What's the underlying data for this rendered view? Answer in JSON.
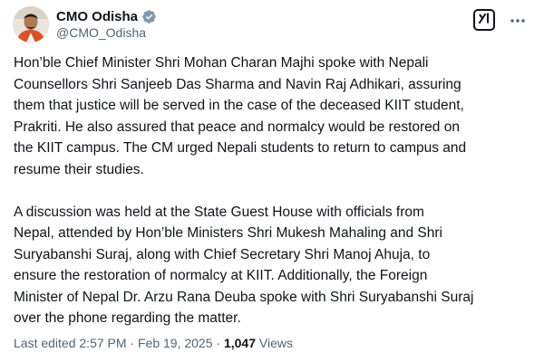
{
  "author": {
    "display_name": "CMO Odisha",
    "handle": "@CMO_Odisha",
    "verified": true,
    "verified_badge": "verified-gray-icon",
    "badge_color": "#829aab"
  },
  "actions": {
    "grok_icon": "grok-icon",
    "more_icon": "more-icon"
  },
  "tweet": {
    "paragraphs": [
      {
        "lines": [
          "Hon’ble Chief Minister Shri Mohan Charan Majhi spoke with Nepali",
          "Counsellors Shri Sanjeeb Das Sharma and Navin Raj Adhikari, assuring",
          "them that justice will be served in the case of the deceased KIIT student,",
          "Prakriti. He also assured that peace and normalcy would be restored on",
          "the KIIT campus. The CM urged Nepali students to return to campus and",
          "resume their studies."
        ]
      },
      {
        "lines": [
          "A discussion was held at the State Guest House with officials from",
          "Nepal, attended by Hon’ble Ministers Shri Mukesh Mahaling and Shri",
          "Suryabanshi Suraj, along with Chief Secretary Shri Manoj Ahuja, to",
          "ensure the restoration of normalcy at KIIT. Additionally, the Foreign",
          "Minister of Nepal Dr. Arzu Rana Deuba spoke with Shri Suryabanshi Suraj",
          "over the phone regarding the matter."
        ]
      }
    ]
  },
  "meta": {
    "edited_label": "Last edited",
    "time": "2:57 PM",
    "separator": "·",
    "date": "Feb 19, 2025",
    "views_count": "1,047",
    "views_label": "Views"
  },
  "colors": {
    "text": "#0f1419",
    "secondary": "#536471"
  }
}
